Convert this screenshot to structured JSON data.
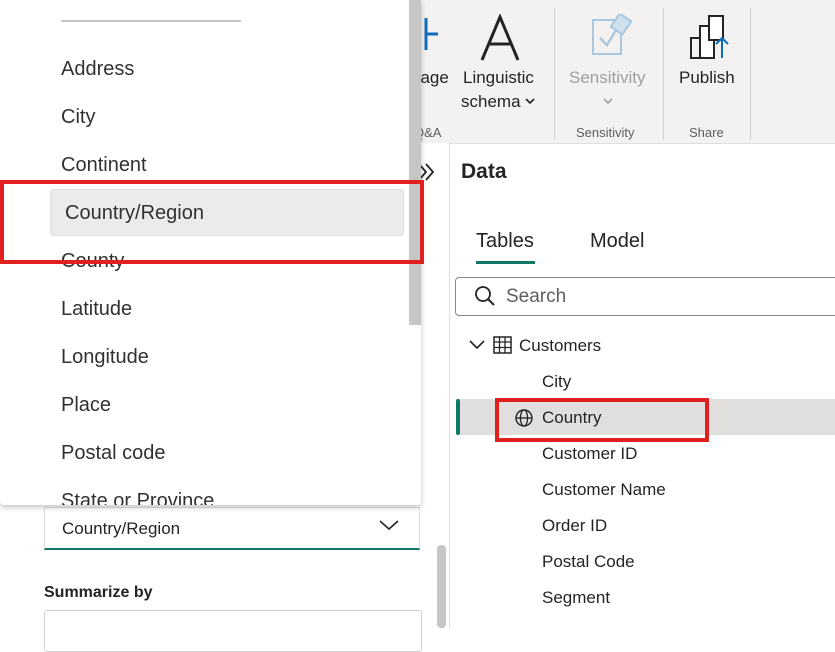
{
  "ribbon": {
    "language_label": "uage",
    "linguistic_label_1": "Linguistic",
    "linguistic_label_2": "schema",
    "qa_group": "Q&A",
    "sensitivity_label": "Sensitivity",
    "sensitivity_group": "Sensitivity",
    "publish_label": "Publish",
    "share_group": "Share"
  },
  "data_pane": {
    "title": "Data",
    "tabs": [
      {
        "label": "Tables",
        "active": true
      },
      {
        "label": "Model",
        "active": false
      }
    ],
    "search": {
      "placeholder": "Search"
    },
    "table": {
      "name": "Customers",
      "fields": [
        {
          "label": "City",
          "icon": ""
        },
        {
          "label": "Country",
          "icon": "globe-icon",
          "selected": true
        },
        {
          "label": "Customer ID",
          "icon": ""
        },
        {
          "label": "Customer Name",
          "icon": ""
        },
        {
          "label": "Order ID",
          "icon": ""
        },
        {
          "label": "Postal Code",
          "icon": ""
        },
        {
          "label": "Segment",
          "icon": ""
        }
      ]
    }
  },
  "data_category_popup": {
    "options": [
      "Address",
      "City",
      "Continent",
      "Country/Region",
      "County",
      "Latitude",
      "Longitude",
      "Place",
      "Postal code",
      "State or Province"
    ],
    "highlighted": "Country/Region"
  },
  "properties": {
    "data_category_value": "Country/Region",
    "summarize_label": "Summarize by"
  },
  "colors": {
    "accent": "#117865",
    "annotation": "#e0201f",
    "ribbon_bg": "#f3f2f1",
    "selection_bg": "#e1dfdd"
  }
}
